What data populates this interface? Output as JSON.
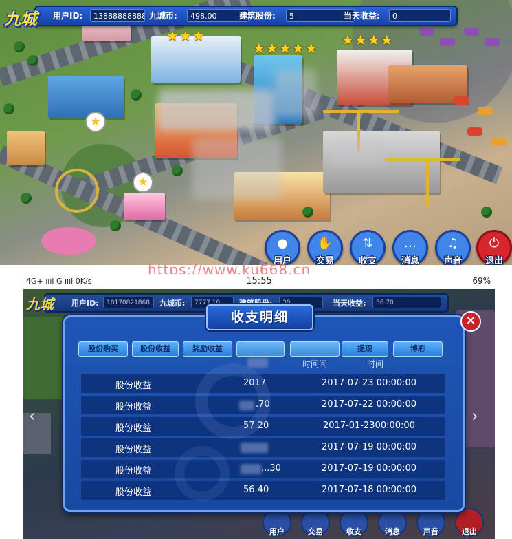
{
  "top_panel": {
    "logo": "九城",
    "user_id_label": "用户ID:",
    "user_id_value": "13888888888",
    "coins_label": "九城币:",
    "coins_value": "498.00",
    "shares_label": "建筑股份:",
    "shares_value": "5",
    "daily_income_label": "当天收益:",
    "daily_income_value": "0",
    "stars": {
      "left_building": "★★★",
      "center_building": "★★★★★",
      "right_building": "★★★★"
    },
    "buttons": [
      {
        "label": "用户",
        "icon": "user-icon",
        "color": "#3f86e8"
      },
      {
        "label": "交易",
        "icon": "handshake-icon",
        "color": "#3f86e8"
      },
      {
        "label": "收支",
        "icon": "updown-arrows-icon",
        "color": "#3f86e8"
      },
      {
        "label": "消息",
        "icon": "chat-bubble-icon",
        "color": "#3f86e8"
      },
      {
        "label": "声音",
        "icon": "sound-icon",
        "color": "#3f86e8"
      },
      {
        "label": "退出",
        "icon": "power-icon",
        "color": "#d8262e"
      }
    ]
  },
  "watermark": "https://www.ku668.cn",
  "bottom_panel": {
    "status_bar": {
      "left": "4G+ ıııl G ıııl 0K/s",
      "time": "15:55",
      "right": "69%"
    },
    "logo": "九城",
    "user_id_label": "用户ID:",
    "user_id_value": "18170821868",
    "coins_label": "九城币:",
    "coins_value": "7777.10",
    "shares_label": "建筑股份:",
    "shares_value": "30",
    "daily_income_label": "当天收益:",
    "daily_income_value": "56.70",
    "modal": {
      "title": "收支明细",
      "close": "×",
      "tabs": [
        "股份购买",
        "股份收益",
        "奖励收益",
        "",
        "",
        "提现",
        "博彩"
      ],
      "headers": [
        "时间间",
        "时间"
      ],
      "rows": [
        {
          "type": "股份收益",
          "amount": "2017-",
          "time": "2017-07-23 00:00:00"
        },
        {
          "type": "股份收益",
          "amount": ".70",
          "time": "2017-07-22 00:00:00"
        },
        {
          "type": "股份收益",
          "amount": "57.20",
          "time": "2017-01-2300:00:00"
        },
        {
          "type": "股份收益",
          "amount": "",
          "time": "2017-07-19 00:00:00"
        },
        {
          "type": "股份收益",
          "amount": "...30",
          "time": "2017-07-19 00:00:00"
        },
        {
          "type": "股份收益",
          "amount": "56.40",
          "time": "2017-07-18 00:00:00"
        }
      ]
    },
    "buttons": [
      "用户",
      "交易",
      "收支",
      "消息",
      "声音",
      "退出"
    ]
  },
  "colors": {
    "bar_blue": "#1d4fc0",
    "modal_blue": "#1849a1",
    "row_dark": "#0e3480",
    "tab_light": "#5ab3ff",
    "exit_red": "#d8262e",
    "star_gold": "#ffd21c",
    "watermark_pink": "#e57a7a"
  }
}
